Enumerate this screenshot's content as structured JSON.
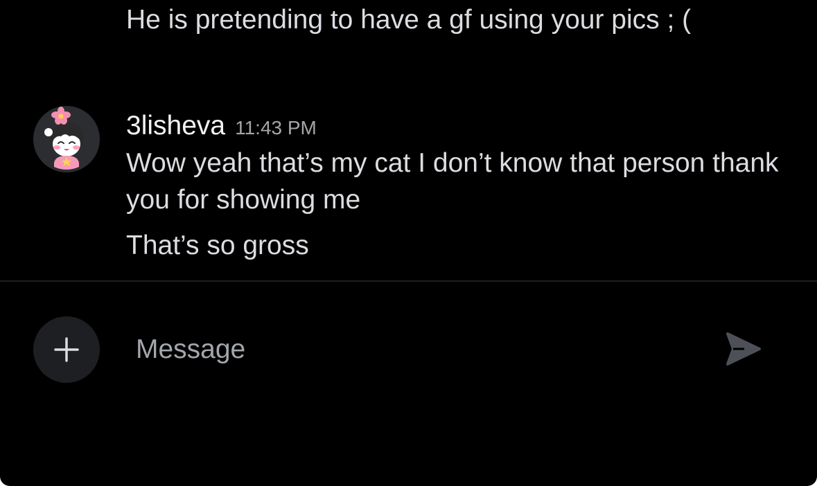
{
  "chat": {
    "previous_message": {
      "text": "He is pretending to have a gf using your pics ; ("
    },
    "message_group": {
      "username": "3lisheva",
      "timestamp": "11:43 PM",
      "avatar_icon": "anime-girl-avatar-icon",
      "messages": [
        "Wow yeah that’s my cat I don’t know that person thank you for showing me",
        "That’s so gross"
      ]
    }
  },
  "composer": {
    "plus_icon": "plus-icon",
    "placeholder": "Message",
    "value": "",
    "send_icon": "send-arrow-icon"
  },
  "colors": {
    "background": "#000000",
    "text": "#dcdde1",
    "muted": "#a3a6aa",
    "username": "#f2f3f5",
    "control_bg": "#1e1f22",
    "send_icon": "#4e5058"
  }
}
